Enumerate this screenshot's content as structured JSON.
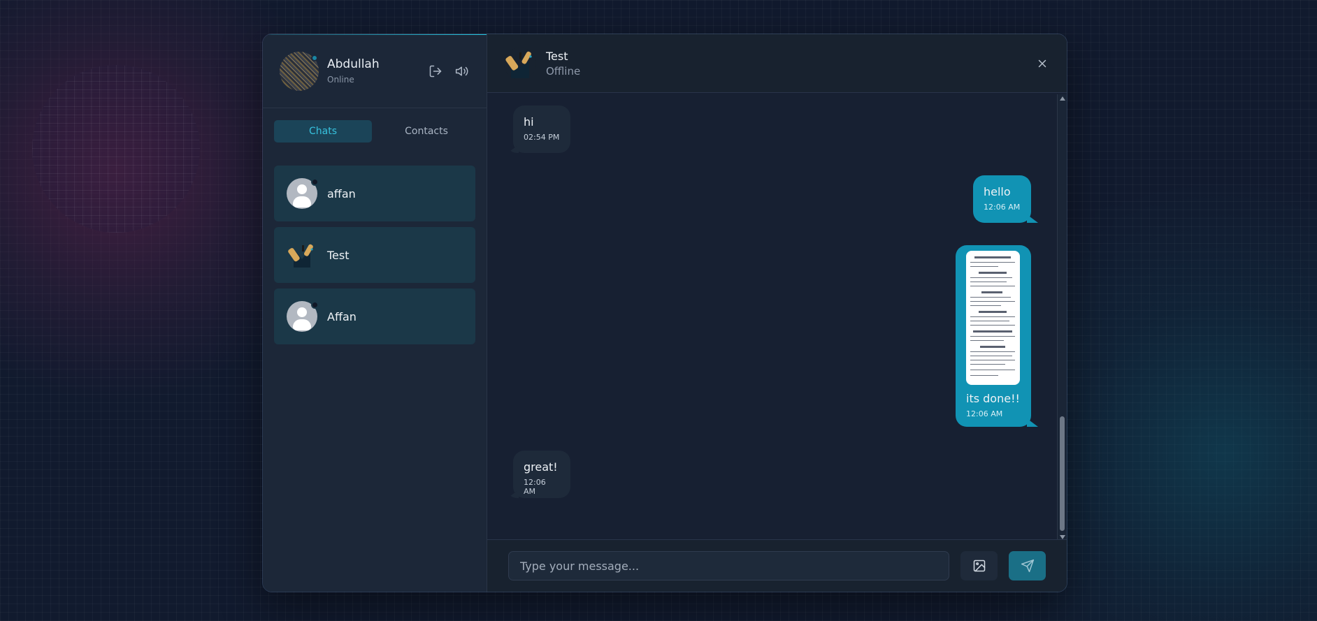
{
  "user": {
    "name": "Abdullah",
    "status": "Online"
  },
  "tabs": [
    {
      "label": "Chats",
      "active": true
    },
    {
      "label": "Contacts",
      "active": false
    }
  ],
  "chats": [
    {
      "name": "affan",
      "avatar": "default-avatar"
    },
    {
      "name": "Test",
      "avatar": "test-avatar"
    },
    {
      "name": "Affan",
      "avatar": "default-avatar"
    }
  ],
  "active_chat": {
    "name": "Test",
    "status": "Offline"
  },
  "messages": [
    {
      "direction": "in",
      "text": "hi",
      "time": "02:54 PM"
    },
    {
      "direction": "out",
      "text": "hello",
      "time": "12:06 AM"
    },
    {
      "direction": "out",
      "attachment": "document-image",
      "text": "its done!!",
      "time": "12:06 AM"
    },
    {
      "direction": "in",
      "text": "great!",
      "time": "12:06 AM"
    }
  ],
  "composer": {
    "placeholder": "Type your message..."
  },
  "icons": {
    "logout": "logout-icon",
    "sound": "volume-icon",
    "close": "close-icon",
    "image": "image-icon",
    "send": "send-icon"
  },
  "colors": {
    "accent": "#1193b4",
    "tab_active_text": "#37c2de",
    "chat_item_bg": "#1b3848",
    "incoming_bubble": "#1e2a3a"
  }
}
